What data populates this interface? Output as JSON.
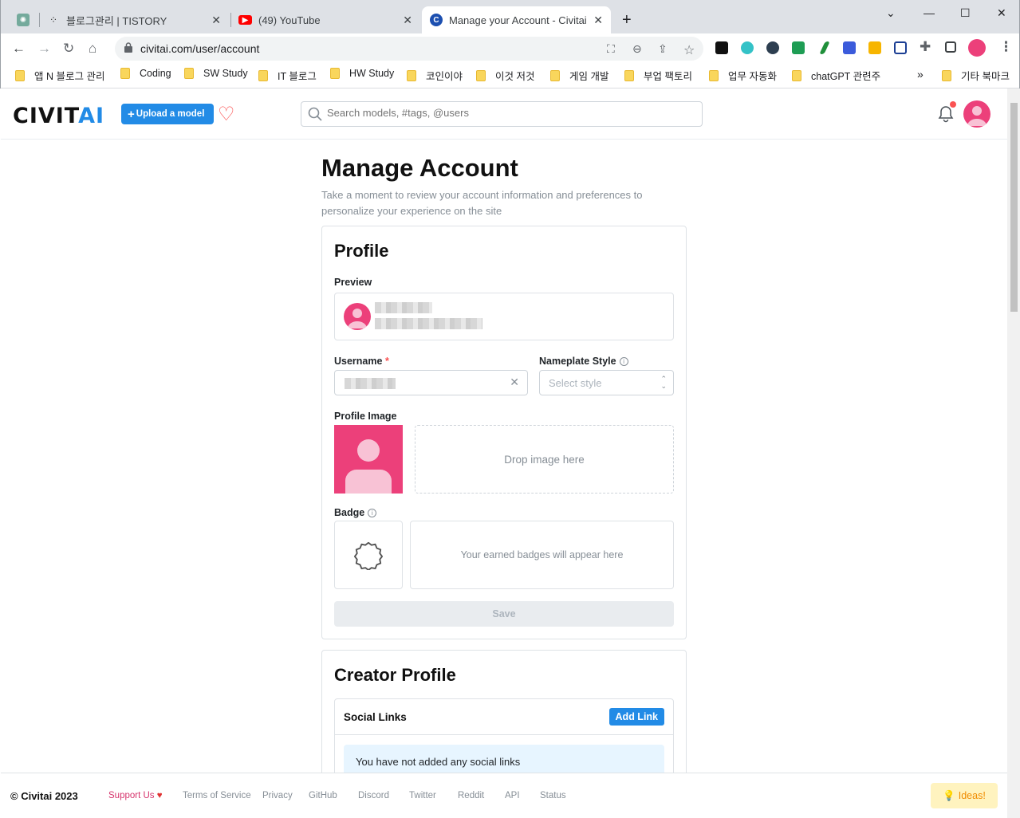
{
  "browser": {
    "tabs": [
      {
        "label": "",
        "icon": "chatgpt-icon"
      },
      {
        "label": "블로그관리 | TISTORY",
        "icon": "tistory-icon"
      },
      {
        "label": "(49) YouTube",
        "icon": "youtube-icon"
      },
      {
        "label": "Manage your Account - Civitai",
        "icon": "civitai-icon",
        "active": true
      }
    ],
    "url": "civitai.com/user/account",
    "bookmarks": [
      "앱 N 블로그 관리",
      "Coding",
      "SW Study",
      "IT 블로그",
      "HW Study",
      "코인이야",
      "이것 저것",
      "게임 개발",
      "부업 팩토리",
      "업무 자동화",
      "chatGPT 관련주"
    ],
    "bookmarks_overflow": "»",
    "other_bookmarks": "기타 북마크"
  },
  "header": {
    "logo_main": "CIVIT",
    "logo_ai": "AI",
    "upload_label": "Upload a model",
    "search_placeholder": "Search models, #tags, @users"
  },
  "page": {
    "title": "Manage Account",
    "subtitle": "Take a moment to review your account information and preferences to personalize your experience on the site"
  },
  "profile": {
    "heading": "Profile",
    "preview_label": "Preview",
    "username_label": "Username",
    "required_mark": "*",
    "nameplate_label": "Nameplate Style",
    "nameplate_placeholder": "Select style",
    "profile_image_label": "Profile Image",
    "drop_text": "Drop image here",
    "badge_label": "Badge",
    "badge_empty": "Your earned badges will appear here",
    "save_label": "Save"
  },
  "creator": {
    "heading": "Creator Profile",
    "social_links_label": "Social Links",
    "add_link_label": "Add Link",
    "empty_message": "You have not added any social links"
  },
  "footer": {
    "copyright": "© Civitai 2023",
    "support": "Support Us",
    "links": [
      "Terms of Service",
      "Privacy",
      "GitHub",
      "Discord",
      "Twitter",
      "Reddit",
      "API",
      "Status"
    ],
    "ideas": "Ideas!"
  },
  "colors": {
    "accent": "#228be6",
    "avatar": "#ec407a",
    "danger": "#fa5252"
  }
}
